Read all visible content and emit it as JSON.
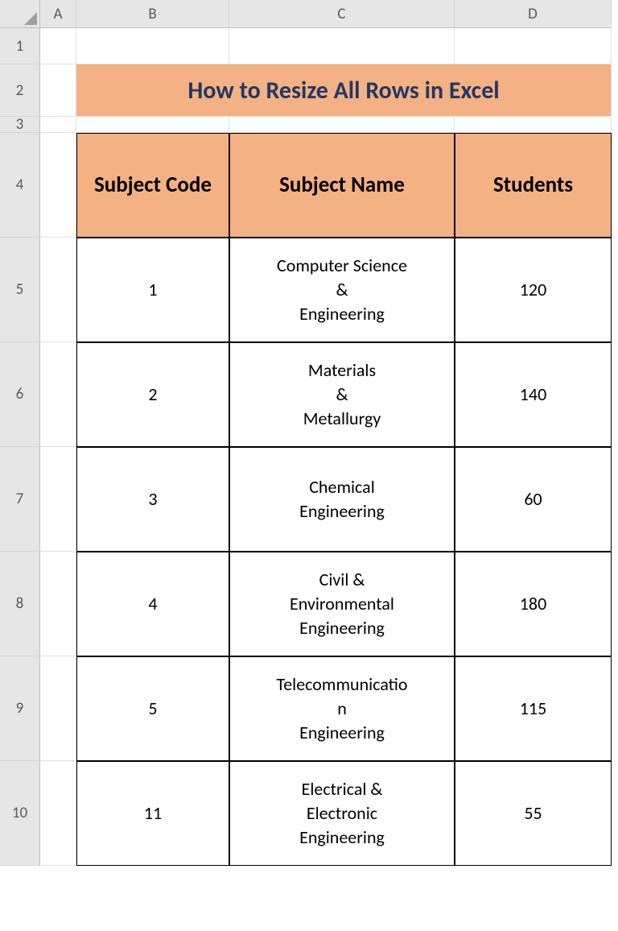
{
  "columns": [
    "A",
    "B",
    "C",
    "D"
  ],
  "rows": [
    "1",
    "2",
    "3",
    "4",
    "5",
    "6",
    "7",
    "8",
    "9",
    "10"
  ],
  "title": "How to Resize All Rows in Excel",
  "headers": {
    "col1": "Subject Code",
    "col2": "Subject Name",
    "col3": "Students"
  },
  "data": [
    {
      "code": "1",
      "name": "Computer Science\n&\nEngineering",
      "students": "120"
    },
    {
      "code": "2",
      "name": "Materials\n&\nMetallurgy",
      "students": "140"
    },
    {
      "code": "3",
      "name": "Chemical\nEngineering",
      "students": "60"
    },
    {
      "code": "4",
      "name": "Civil &\nEnvironmental\nEngineering",
      "students": "180"
    },
    {
      "code": "5",
      "name": "Telecommunicatio\nn\nEngineering",
      "students": "115"
    },
    {
      "code": "11",
      "name": "Electrical &\nElectronic\nEngineering",
      "students": "55"
    }
  ]
}
